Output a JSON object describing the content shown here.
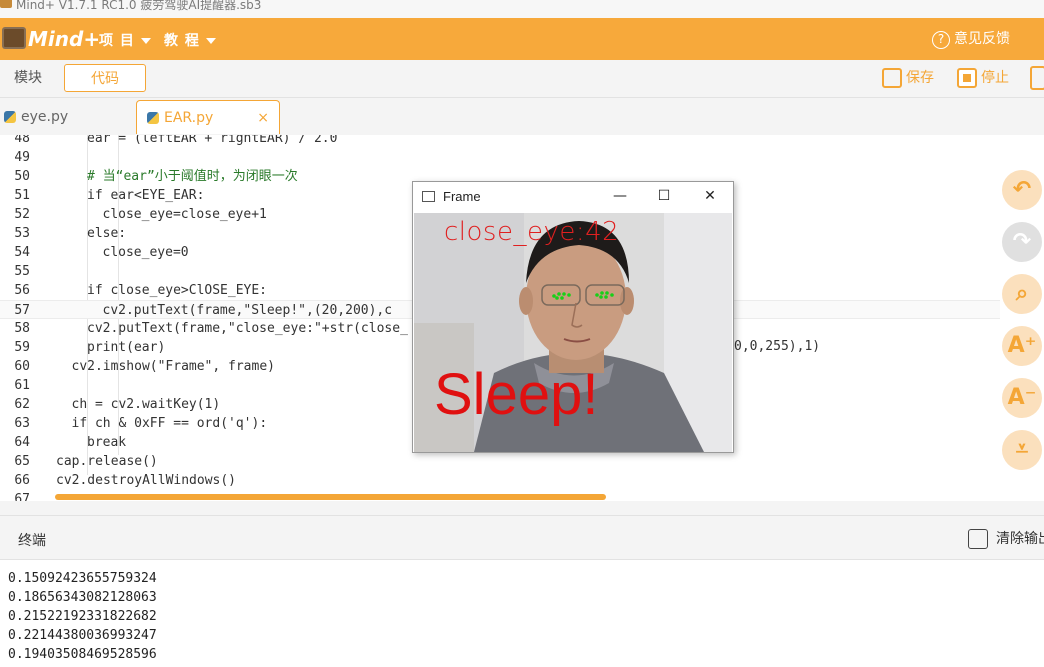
{
  "titlebar": {
    "text": "Mind+ V1.7.1 RC1.0   疲劳驾驶AI提醒器.sb3"
  },
  "menubar": {
    "logo": "Mind+",
    "menus": [
      "项 目",
      "教 程"
    ],
    "feedback": "意见反馈"
  },
  "toolbar": {
    "mode_tabs": [
      "模块",
      "代码"
    ],
    "save_label": "保存",
    "stop_label": "停止"
  },
  "file_tabs": [
    {
      "name": "eye.py",
      "active": false
    },
    {
      "name": "EAR.py",
      "active": true,
      "close": "×"
    }
  ],
  "editor": {
    "lines": [
      {
        "n": "48",
        "indent": 2,
        "code": "ear = (leftEAR + rightEAR) / 2.0"
      },
      {
        "n": "49",
        "indent": 0,
        "code": ""
      },
      {
        "n": "50",
        "indent": 2,
        "code": "# 当“ear”小于阈值时，为闭眼一次"
      },
      {
        "n": "51",
        "indent": 2,
        "code": "if ear<EYE_EAR:"
      },
      {
        "n": "52",
        "indent": 3,
        "code": "close_eye=close_eye+1"
      },
      {
        "n": "53",
        "indent": 2,
        "code": "else:"
      },
      {
        "n": "54",
        "indent": 3,
        "code": "close_eye=0"
      },
      {
        "n": "55",
        "indent": 0,
        "code": ""
      },
      {
        "n": "56",
        "indent": 2,
        "code": "if close_eye>ClOSE_EYE:"
      },
      {
        "n": "57",
        "indent": 3,
        "code": "cv2.putText(frame,\"Sleep!\",(20,200),c"
      },
      {
        "n": "58",
        "indent": 2,
        "code": "cv2.putText(frame,\"close_eye:\"+str(close_"
      },
      {
        "n": "59",
        "indent": 2,
        "code": "print(ear)"
      },
      {
        "n": "60",
        "indent": 1,
        "code": "cv2.imshow(\"Frame\", frame)"
      },
      {
        "n": "61",
        "indent": 0,
        "code": ""
      },
      {
        "n": "62",
        "indent": 1,
        "code": "ch = cv2.waitKey(1)"
      },
      {
        "n": "63",
        "indent": 1,
        "code": "if ch & 0xFF == ord('q'):"
      },
      {
        "n": "64",
        "indent": 2,
        "code": "break"
      },
      {
        "n": "65",
        "indent": 0,
        "code": "cap.release()"
      },
      {
        "n": "66",
        "indent": 0,
        "code": "cv2.destroyAllWindows()"
      },
      {
        "n": "67",
        "indent": 0,
        "code": ""
      }
    ],
    "line58_tail": "0,0,255),1)"
  },
  "side_buttons": [
    {
      "icon": "undo-icon",
      "glyph": "↶",
      "enabled": true
    },
    {
      "icon": "redo-icon",
      "glyph": "↷",
      "enabled": false
    },
    {
      "icon": "search-icon",
      "glyph": "⌕",
      "enabled": true
    },
    {
      "icon": "font-increase-icon",
      "glyph": "A⁺",
      "enabled": true
    },
    {
      "icon": "font-decrease-icon",
      "glyph": "A⁻",
      "enabled": true
    },
    {
      "icon": "collapse-top-icon",
      "glyph": "⩡",
      "enabled": true
    }
  ],
  "terminal": {
    "title": "终端",
    "clear_label": "清除输出",
    "output": [
      "0.15092423655759324",
      "0.18656343082128063",
      "0.21522192331822682",
      "0.22144380036993247",
      "0.19403508469528596"
    ]
  },
  "frame_window": {
    "title": "Frame",
    "overlay_count": "close_eye:42",
    "overlay_alert": "Sleep!",
    "controls": [
      "—",
      "☐",
      "✕"
    ]
  },
  "colors": {
    "accent": "#f7a93b",
    "alert_text": "#e01010"
  }
}
